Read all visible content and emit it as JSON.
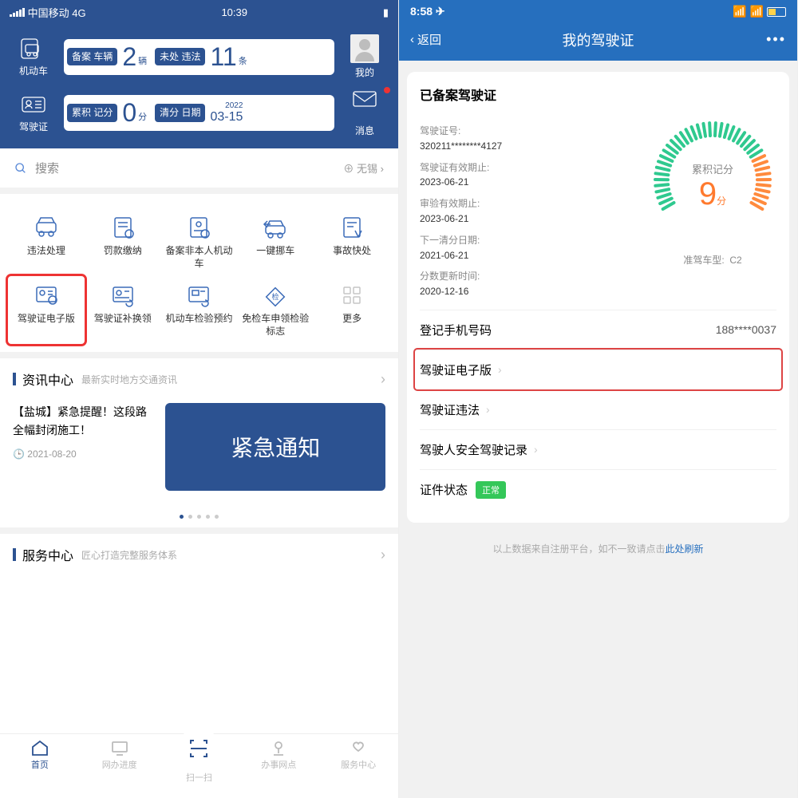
{
  "left": {
    "status": {
      "carrier": "中国移动 4G",
      "time": "10:39"
    },
    "sideL1": "机动车",
    "sideR1": "我的",
    "sideL2": "驾驶证",
    "sideR2": "消息",
    "chip1": {
      "lab": "备案\n车辆",
      "num": "2",
      "unit": "辆"
    },
    "chip2": {
      "lab": "未处\n违法",
      "num": "11",
      "unit": "条"
    },
    "chip3": {
      "lab": "累积\n记分",
      "num": "0",
      "unit": "分"
    },
    "chip4": {
      "lab": "清分\n日期",
      "yr": "2022",
      "num": "03-15"
    },
    "search": {
      "ph": "搜索",
      "loc": "无锡"
    },
    "grid": [
      "违法处理",
      "罚款缴纳",
      "备案非本人机动车",
      "一键挪车",
      "事故快处",
      "驾驶证电子版",
      "驾驶证补换领",
      "机动车检验预约",
      "免检车申领检验标志",
      "更多"
    ],
    "sec1": {
      "t": "资讯中心",
      "s": "最新实时地方交通资讯"
    },
    "news": {
      "headline": "【盐城】紧急提醒！这段路全幅封闭施工！",
      "date": "2021-08-20",
      "banner": "紧急通知"
    },
    "sec2": {
      "t": "服务中心",
      "s": "匠心打造完整服务体系"
    },
    "tabs": [
      "首页",
      "网办进度",
      "扫一扫",
      "办事网点",
      "服务中心"
    ]
  },
  "right": {
    "status": {
      "time": "8:58"
    },
    "nav": {
      "back": "返回",
      "title": "我的驾驶证"
    },
    "card": {
      "title": "已备案驾驶证",
      "fields": [
        {
          "k": "驾驶证号:",
          "v": "320211********4127"
        },
        {
          "k": "驾驶证有效期止:",
          "v": "2023-06-21"
        },
        {
          "k": "审验有效期止:",
          "v": "2023-06-21"
        },
        {
          "k": "下一清分日期:",
          "v": "2021-06-21"
        },
        {
          "k": "分数更新时间:",
          "v": "2020-12-16"
        }
      ],
      "gauge": {
        "label": "累积记分",
        "value": "9",
        "unit": "分"
      },
      "carclass": {
        "k": "准驾车型:",
        "v": "C2"
      },
      "rows": [
        {
          "t": "登记手机号码",
          "rv": "188****0037"
        },
        {
          "t": "驾驶证电子版",
          "hl": true,
          "chev": true
        },
        {
          "t": "驾驶证违法",
          "chev": true
        },
        {
          "t": "驾驶人安全驾驶记录",
          "chev": true
        },
        {
          "t": "证件状态",
          "badge": "正常"
        }
      ]
    },
    "footer": {
      "txt": "以上数据来自注册平台，如不一致请点击",
      "link": "此处刷新"
    }
  }
}
